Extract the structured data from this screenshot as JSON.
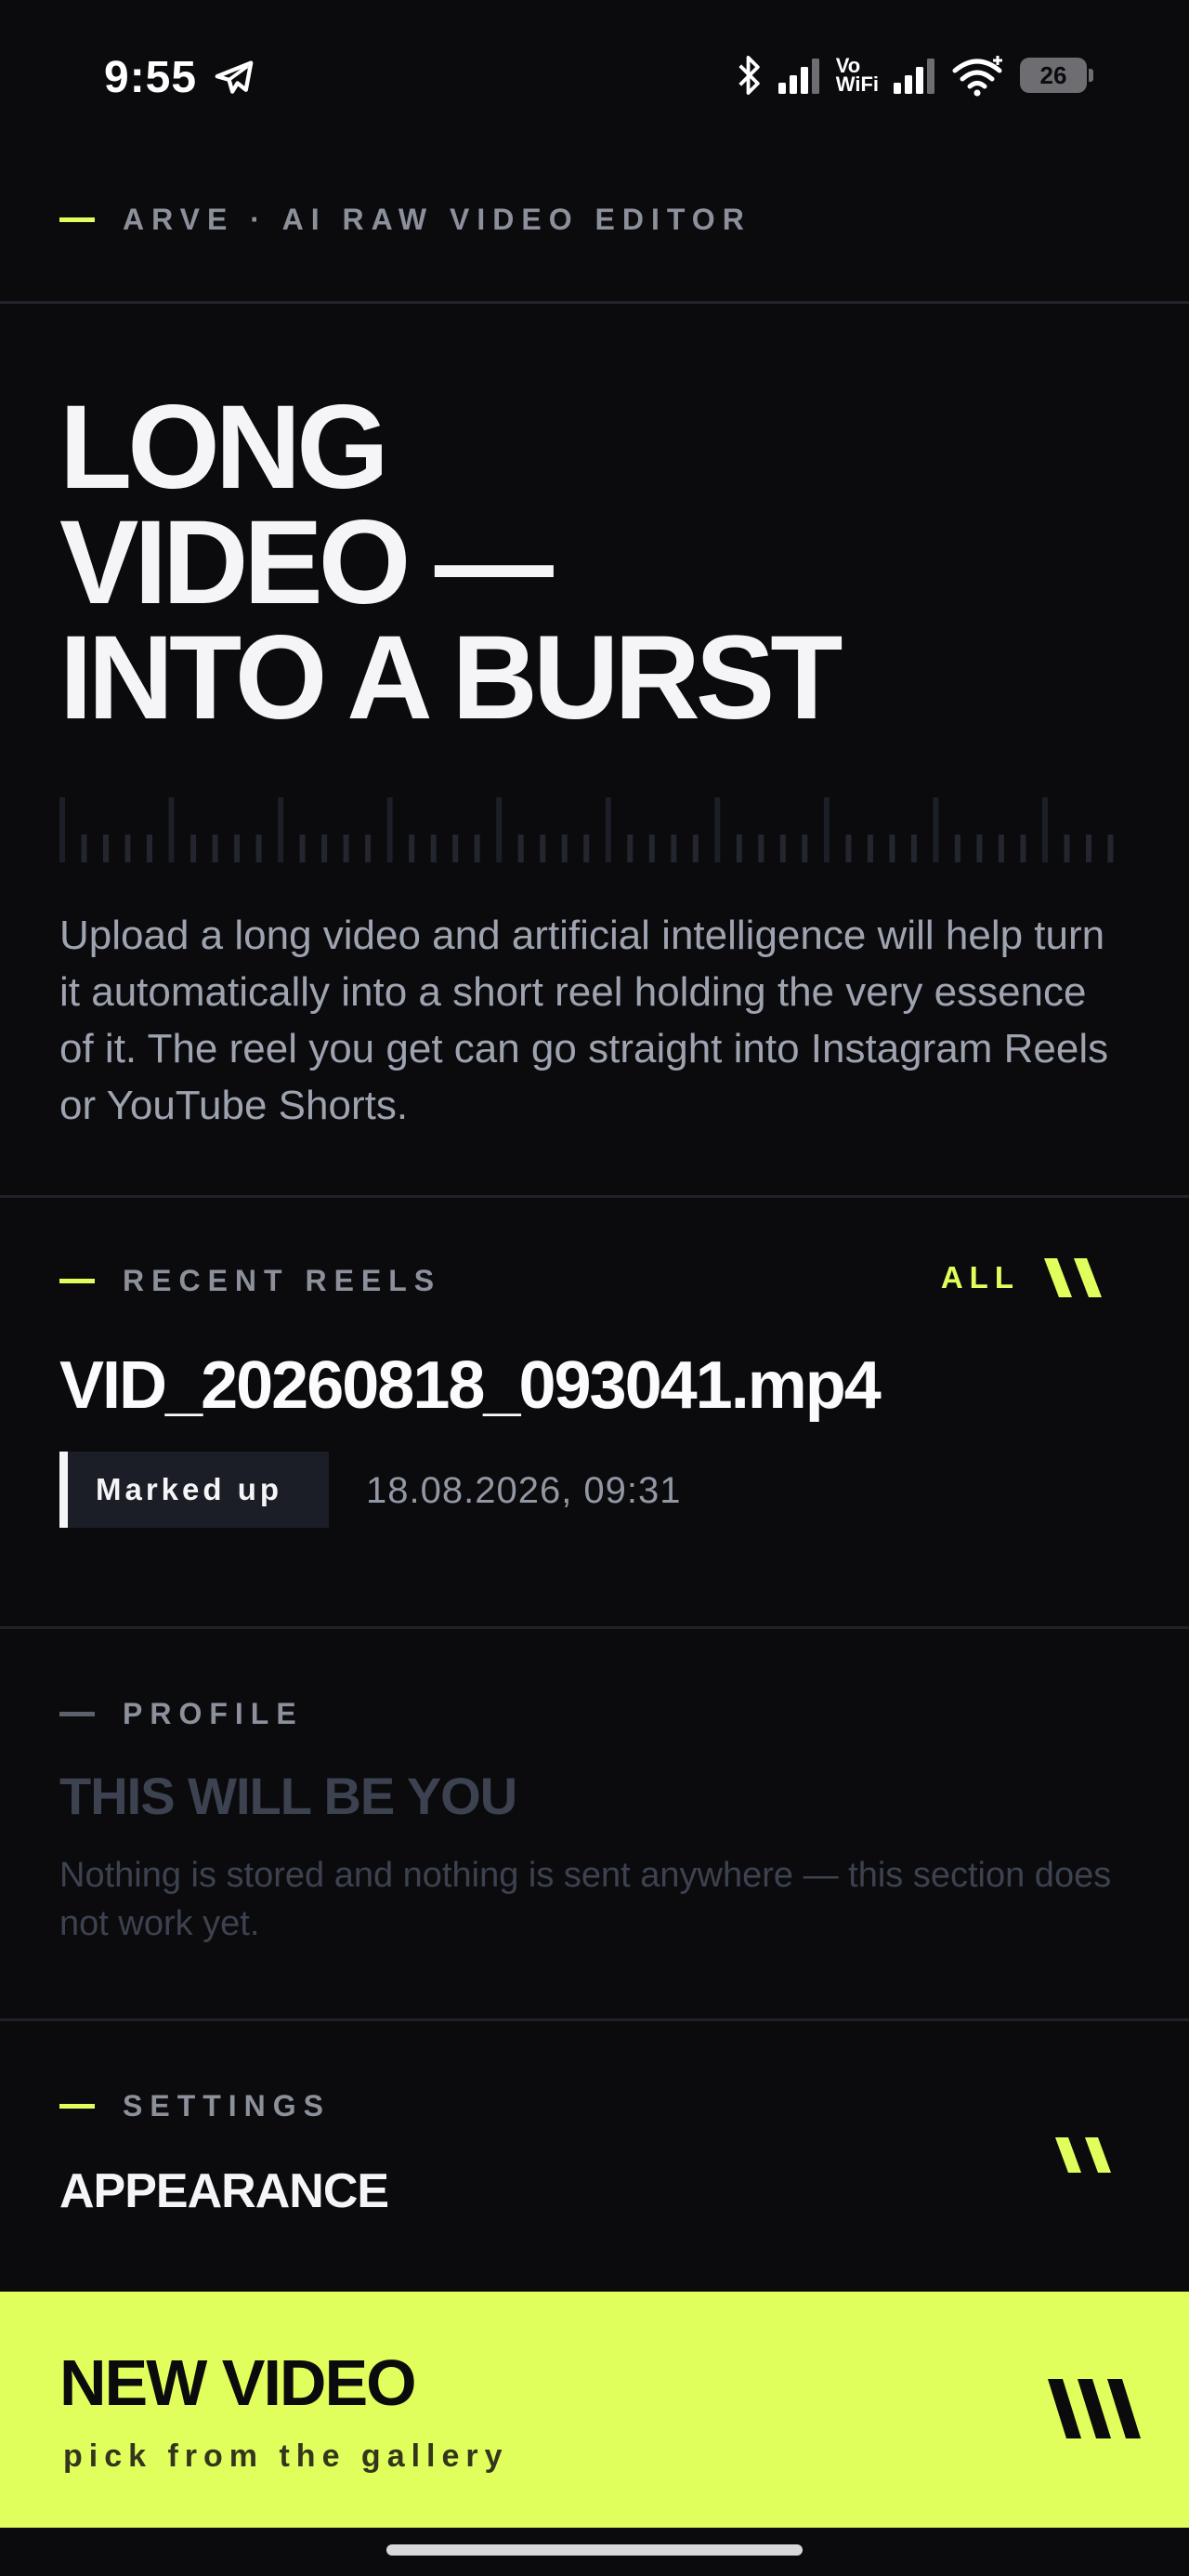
{
  "status_bar": {
    "time": "9:55",
    "icons": [
      "telegram-icon",
      "bluetooth-icon",
      "signal-icon",
      "vowifi-icon",
      "signal-icon",
      "wifi-icon"
    ],
    "vowifi_top": "Vo",
    "vowifi_bottom": "WiFi",
    "battery": "26"
  },
  "header": {
    "eyebrow": "ARVE · AI RAW VIDEO EDITOR"
  },
  "hero": {
    "title_lines": [
      "LONG",
      "VIDEO —",
      "INTO A BURST"
    ],
    "description": "Upload a long video and artificial intelligence will help turn it automatically into a short reel holding the very essence of it. The reel you get can go straight into Instagram Reels or YouTube Shorts."
  },
  "recent_reels": {
    "label": "RECENT REELS",
    "all_label": "ALL",
    "item": {
      "title": "VID_20260818_093041.mp4",
      "badge": "Marked up",
      "date": "18.08.2026, 09:31"
    }
  },
  "profile": {
    "label": "PROFILE",
    "title": "THIS WILL BE YOU",
    "note": "Nothing is stored and nothing is sent anywhere — this section does not work yet."
  },
  "settings": {
    "label": "SETTINGS",
    "title": "APPEARANCE"
  },
  "new_video": {
    "title": "NEW VIDEO",
    "subtitle": "pick from the gallery"
  },
  "colors": {
    "background": "#0b0b0e",
    "accent": "#e1ff5c",
    "muted_text": "#8c909b",
    "disabled_text": "#3d4250",
    "divider": "#20232a"
  }
}
